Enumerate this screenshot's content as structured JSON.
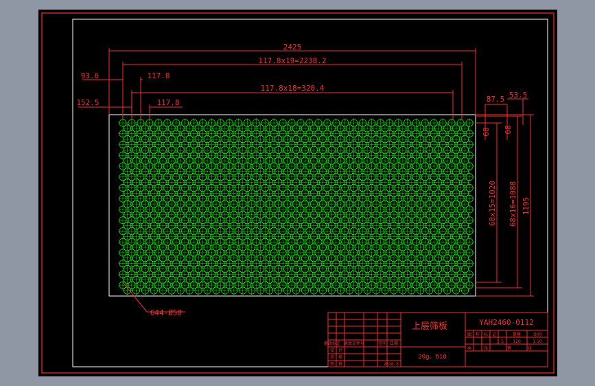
{
  "drawing": {
    "title_cn": "上层筛板",
    "drawing_no": "YAH2460-0112",
    "material": "20g、δ10",
    "date": "2010.6",
    "hole_note": "644-Ø50",
    "dims": {
      "overall_width": "2425",
      "row_span_a": "117.8x19=2238.2",
      "row_span_b": "117.8x18=320.4",
      "left_offset_a": "93.6",
      "pitch_a": "117.8",
      "left_offset_b": "152.5",
      "pitch_b": "117.8",
      "right_a": "87.5",
      "right_b": "53.5",
      "vert_small_a": "68",
      "vert_small_b": "68",
      "vert_span_a": "68x15=1020",
      "vert_span_b": "68x16=1088",
      "overall_height": "1195"
    },
    "title_block": {
      "mid_row1": [
        "更改标记",
        "更改文件号",
        "签字",
        "日期"
      ],
      "mid_row2": [
        "设",
        "计"
      ],
      "mid_row3": [
        "校",
        "核"
      ],
      "mid_row4": [
        "审",
        "核"
      ],
      "right_header": [
        "图",
        "样",
        "标",
        "记",
        "重量",
        "比例"
      ],
      "right_values": [
        "S",
        "120",
        "1:10"
      ],
      "right_footer": [
        "共",
        "张",
        "第",
        "张"
      ]
    }
  },
  "colors": {
    "frame": "#ff2a2a",
    "holes": "#00ff00",
    "plate": "#ffffff",
    "background": "#000000"
  }
}
